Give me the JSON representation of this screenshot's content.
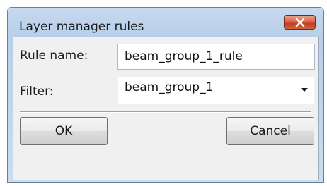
{
  "window": {
    "title": "Layer manager rules",
    "close_icon": "close-icon"
  },
  "form": {
    "rule_name_label": "Rule name:",
    "rule_name_value": "beam_group_1_rule",
    "filter_label": "Filter:",
    "filter_value": "beam_group_1"
  },
  "buttons": {
    "ok_label": "OK",
    "cancel_label": "Cancel"
  },
  "colors": {
    "close_button": "#c7472a",
    "titlebar": "#bfd4ec",
    "client": "#f0f0f0"
  }
}
